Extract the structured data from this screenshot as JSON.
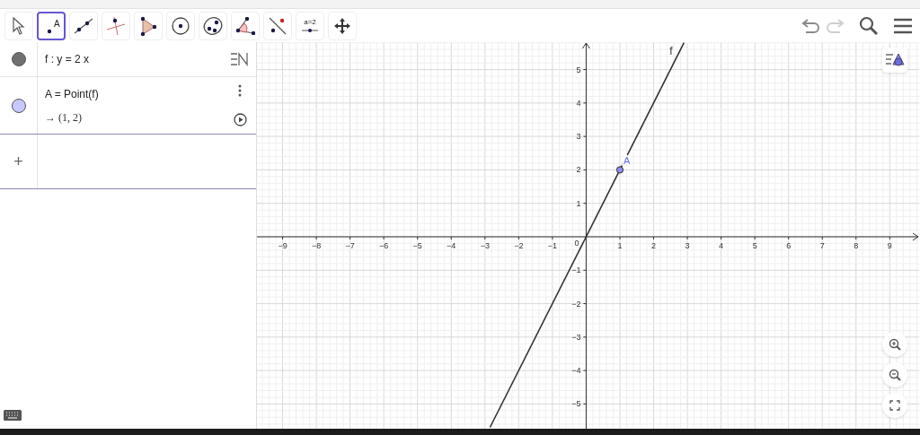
{
  "toolbar": {
    "tools": [
      {
        "selected": false
      },
      {
        "selected": true,
        "label": "A"
      },
      {
        "selected": false
      },
      {
        "selected": false
      },
      {
        "selected": false
      },
      {
        "selected": false
      },
      {
        "selected": false
      },
      {
        "selected": false
      },
      {
        "selected": false
      },
      {
        "selected": false,
        "label": "a=2"
      },
      {
        "selected": false
      }
    ],
    "undo": {
      "disabled": false
    },
    "redo": {
      "disabled": true
    }
  },
  "algebra": {
    "items": [
      {
        "kind": "function",
        "color": "#707070",
        "definition": "f : y = 2 x",
        "selected": false
      },
      {
        "kind": "point",
        "color": "#c8c8ff",
        "definition": "A = Point(f)",
        "output": "→ (1, 2)",
        "selected": true
      }
    ],
    "input": {
      "symbol": "+"
    }
  },
  "graphics": {
    "chart_data": {
      "type": "line",
      "grid": true,
      "xlim": [
        -9.76,
        9.87
      ],
      "ylim": [
        -5.74,
        5.82
      ],
      "xticks": [
        {
          "value": -9,
          "label": "−9"
        },
        {
          "value": -8,
          "label": "−8"
        },
        {
          "value": -7,
          "label": "−7"
        },
        {
          "value": -6,
          "label": "−6"
        },
        {
          "value": -5,
          "label": "−5"
        },
        {
          "value": -4,
          "label": "−4"
        },
        {
          "value": -3,
          "label": "−3"
        },
        {
          "value": -2,
          "label": "−2"
        },
        {
          "value": -1,
          "label": "−1"
        },
        {
          "value": 1,
          "label": "1"
        },
        {
          "value": 2,
          "label": "2"
        },
        {
          "value": 3,
          "label": "3"
        },
        {
          "value": 4,
          "label": "4"
        },
        {
          "value": 5,
          "label": "5"
        },
        {
          "value": 6,
          "label": "6"
        },
        {
          "value": 7,
          "label": "7"
        },
        {
          "value": 8,
          "label": "8"
        },
        {
          "value": 9,
          "label": "9"
        }
      ],
      "yticks": [
        {
          "value": -5,
          "label": "−5"
        },
        {
          "value": -4,
          "label": "−4"
        },
        {
          "value": -3,
          "label": "−3"
        },
        {
          "value": -2,
          "label": "−2"
        },
        {
          "value": -1,
          "label": "−1"
        },
        {
          "value": 1,
          "label": "1"
        },
        {
          "value": 2,
          "label": "2"
        },
        {
          "value": 3,
          "label": "3"
        },
        {
          "value": 4,
          "label": "4"
        },
        {
          "value": 5,
          "label": "5"
        }
      ],
      "x": [
        -2.85,
        2.9
      ],
      "series": [
        {
          "name": "f",
          "color": "#333333",
          "values": [
            -5.7,
            5.8
          ]
        }
      ],
      "annotations": [
        {
          "text": "A",
          "x": 1,
          "y": 2
        }
      ]
    },
    "origin_label": "0"
  }
}
